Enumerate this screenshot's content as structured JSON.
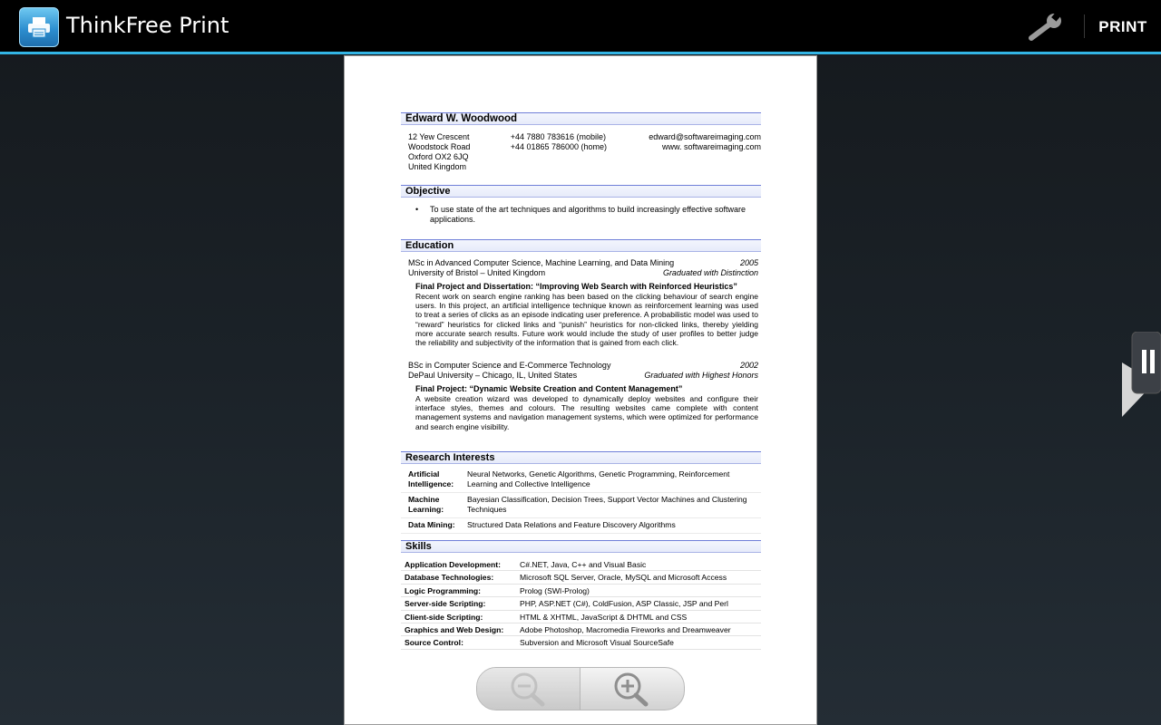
{
  "app": {
    "title": "ThinkFree Print",
    "print_label": "PRINT"
  },
  "icons": {
    "app": "printer-icon",
    "settings": "wrench-icon",
    "zoom_out": "zoom-out-icon",
    "zoom_in": "zoom-in-icon",
    "side": "pause-icon"
  },
  "colors": {
    "accent": "#33b5e5",
    "section_rule": "#6f7fd8"
  },
  "resume": {
    "name": "Edward W. Woodwood",
    "address": [
      "12 Yew Crescent",
      "Woodstock Road",
      "Oxford OX2 6JQ",
      "United Kingdom"
    ],
    "phones": [
      "+44 7880 783616 (mobile)",
      "+44 01865 786000 (home)"
    ],
    "web": [
      "edward@softwareimaging.com",
      "www. softwareimaging.com"
    ],
    "objective_head": "Objective",
    "objective_bullet": "•",
    "objective": "To use state of the art techniques and algorithms to build increasingly effective software applications.",
    "education_head": "Education",
    "education": [
      {
        "degree": "MSc in Advanced Computer Science, Machine Learning, and Data Mining",
        "year": "2005",
        "school": "University of Bristol – United Kingdom",
        "honors": "Graduated with Distinction",
        "project_title": "Final Project and Dissertation: “Improving Web Search with Reinforced Heuristics”",
        "project_body": "Recent work on search engine ranking has been based on the clicking behaviour of search engine users. In this project, an artificial intelligence technique known as reinforcement learning was used to treat a series of clicks as an episode indicating user preference. A probabilistic model was used to “reward” heuristics for clicked links and “punish” heuristics for non-clicked links, thereby yielding more accurate search results. Future work would include the study of user profiles to better judge the reliability and subjectivity of the information that is gained from each click."
      },
      {
        "degree": "BSc in Computer Science and E-Commerce Technology",
        "year": "2002",
        "school": "DePaul University – Chicago, IL, United States",
        "honors": "Graduated with Highest Honors",
        "project_title": "Final Project: “Dynamic Website Creation and Content Management”",
        "project_body": "A website creation wizard was developed to dynamically deploy websites and configure their interface styles, themes and colours. The resulting websites came complete with content management systems and navigation management systems, which were optimized for performance and search engine visibility."
      }
    ],
    "research_head": "Research Interests",
    "research": [
      {
        "k": "Artificial Intelligence:",
        "v": "Neural Networks, Genetic Algorithms, Genetic Programming, Reinforcement Learning and Collective Intelligence"
      },
      {
        "k": "Machine Learning:",
        "v": "Bayesian Classification, Decision Trees, Support Vector Machines and Clustering Techniques"
      },
      {
        "k": "Data Mining:",
        "v": "Structured Data Relations and Feature Discovery Algorithms"
      }
    ],
    "skills_head": "Skills",
    "skills": [
      {
        "k": "Application Development:",
        "v": "C#.NET, Java, C++ and Visual Basic"
      },
      {
        "k": "Database Technologies:",
        "v": "Microsoft SQL Server, Oracle, MySQL and Microsoft Access"
      },
      {
        "k": "Logic Programming:",
        "v": "Prolog (SWI-Prolog)"
      },
      {
        "k": "Server-side Scripting:",
        "v": "PHP, ASP.NET (C#), ColdFusion, ASP Classic, JSP and Perl"
      },
      {
        "k": "Client-side Scripting:",
        "v": "HTML & XHTML, JavaScript & DHTML and CSS"
      },
      {
        "k": "Graphics and Web Design:",
        "v": "Adobe Photoshop, Macromedia Fireworks and Dreamweaver"
      },
      {
        "k": "Source Control:",
        "v": "Subversion and Microsoft Visual SourceSafe"
      }
    ]
  }
}
